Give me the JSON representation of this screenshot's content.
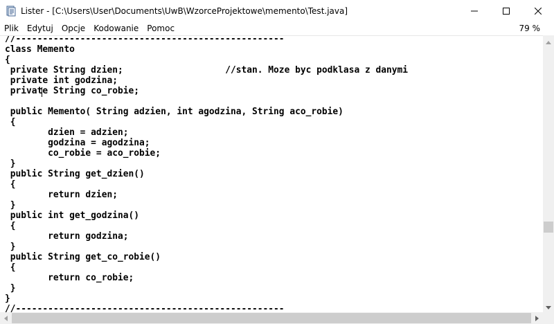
{
  "window": {
    "title": "Lister - [C:\\Users\\User\\Documents\\UwB\\WzorceProjektowe\\memento\\Test.java]",
    "app_icon": "lister-icon",
    "controls": {
      "minimize": "minimize-icon",
      "maximize": "maximize-icon",
      "close": "close-icon"
    }
  },
  "menu": {
    "items": [
      "Plik",
      "Edytuj",
      "Opcje",
      "Kodowanie",
      "Pomoc"
    ],
    "zoom": "79 %"
  },
  "code": {
    "lines": [
      "//--------------------------------------------------",
      "class Memento",
      "{",
      " private String dzien;                   //stan. Moze byc podklasa z danymi",
      " private int godzina;",
      " private String co_robie;",
      "",
      " public Memento( String adzien, int agodzina, String aco_robie)",
      " {",
      "        dzien = adzien;",
      "        godzina = agodzina;",
      "        co_robie = aco_robie;",
      " }",
      " public String get_dzien()",
      " {",
      "        return dzien;",
      " }",
      " public int get_godzina()",
      " {",
      "        return godzina;",
      " }",
      " public String get_co_robie()",
      " {",
      "        return co_robie;",
      " }",
      "}",
      "//--------------------------------------------------"
    ]
  },
  "scrollbars": {
    "vertical_position": 0.72,
    "horizontal_position": 0.0
  }
}
